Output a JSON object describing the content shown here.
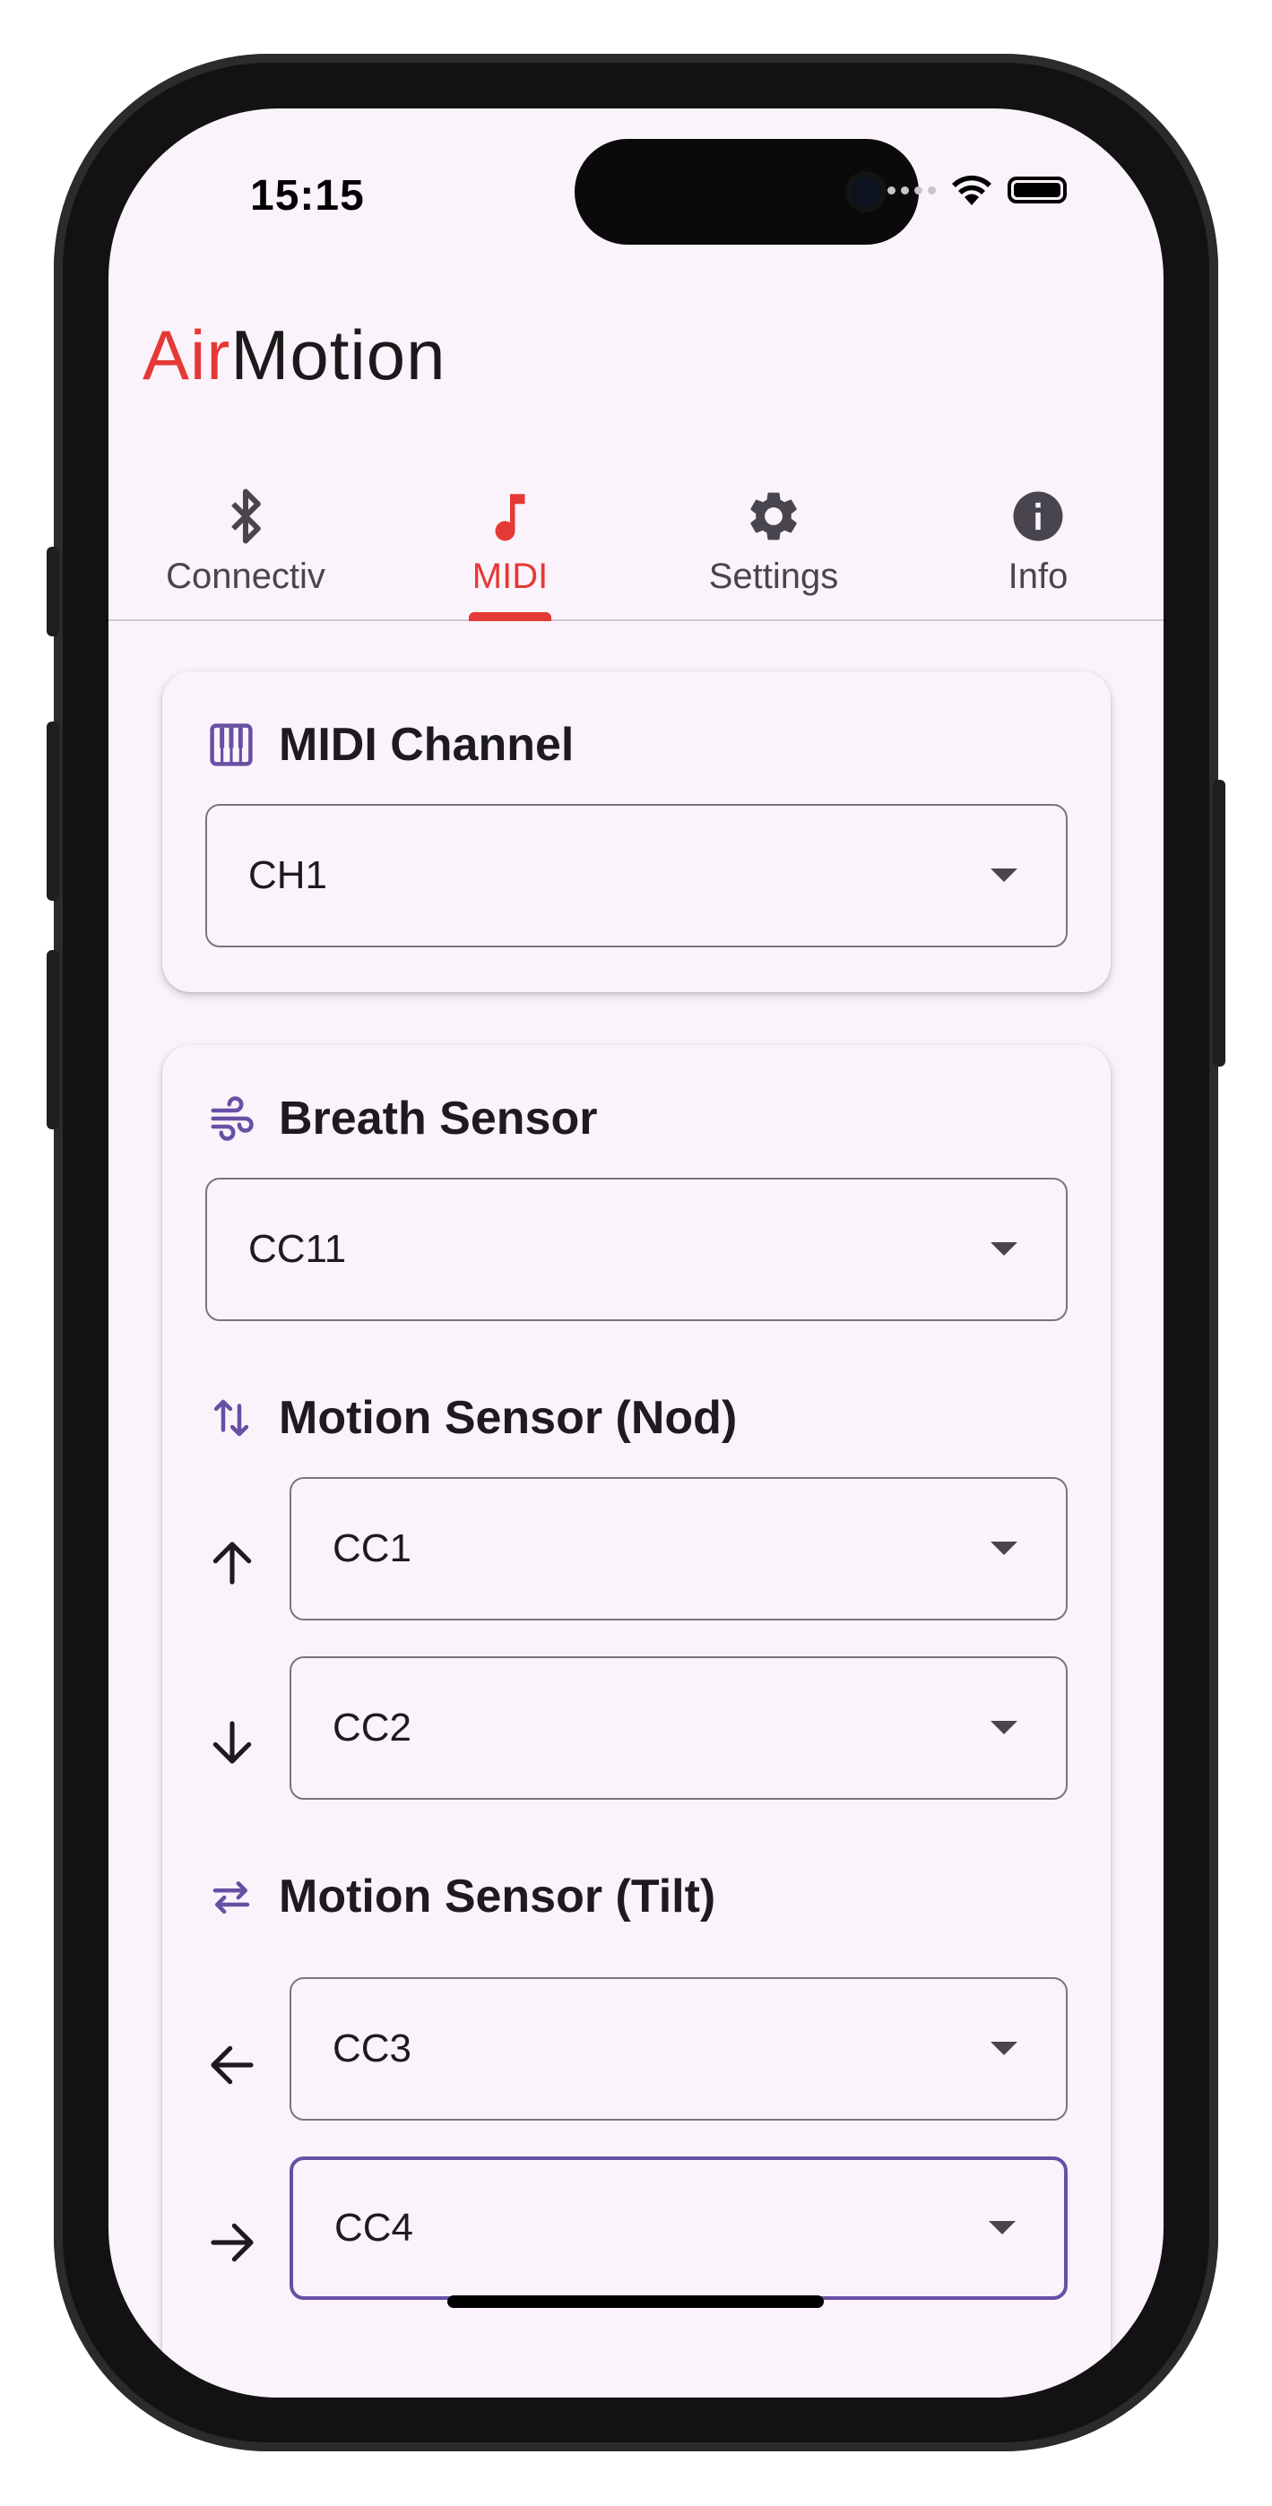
{
  "status_bar": {
    "time": "15:15"
  },
  "app": {
    "logo_part1": "Air",
    "logo_part2": "Motion",
    "accent_color": "#e53935",
    "secondary_color": "#6750a4"
  },
  "tabs": [
    {
      "label": "Connectiv",
      "icon": "bluetooth-icon",
      "active": false
    },
    {
      "label": "MIDI",
      "icon": "music-note-icon",
      "active": true
    },
    {
      "label": "Settings",
      "icon": "gear-icon",
      "active": false
    },
    {
      "label": "Info",
      "icon": "info-icon",
      "active": false
    }
  ],
  "midi_channel": {
    "title": "MIDI Channel",
    "icon": "piano-icon",
    "value": "CH1"
  },
  "breath_sensor": {
    "title": "Breath Sensor",
    "icon": "air-icon",
    "value": "CC11"
  },
  "motion_nod": {
    "title": "Motion Sensor (Nod)",
    "icon": "swap-vertical-icon",
    "up_value": "CC1",
    "down_value": "CC2"
  },
  "motion_tilt": {
    "title": "Motion Sensor (Tilt)",
    "icon": "swap-horizontal-icon",
    "left_value": "CC3",
    "right_value": "CC4"
  }
}
